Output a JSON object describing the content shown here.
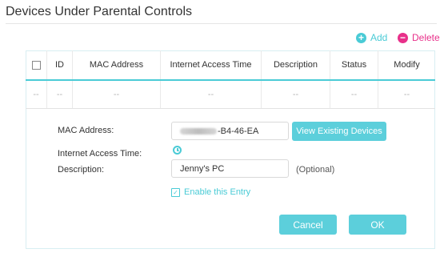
{
  "section": {
    "title": "Devices Under Parental Controls"
  },
  "toolbar": {
    "add_label": "Add",
    "delete_label": "Delete"
  },
  "table": {
    "headers": [
      "ID",
      "MAC Address",
      "Internet Access Time",
      "Description",
      "Status",
      "Modify"
    ],
    "placeholder_row": [
      "--",
      "--",
      "--",
      "--",
      "--",
      "--",
      "--"
    ]
  },
  "form": {
    "mac_label": "MAC Address:",
    "mac_value_visible": "-B4-46-EA",
    "view_devices_label": "View Existing Devices",
    "time_label": "Internet Access Time:",
    "desc_label": "Description:",
    "desc_value": "Jenny's PC",
    "optional_label": "(Optional)",
    "enable_label": "Enable this Entry",
    "enable_checked": true,
    "cancel_label": "Cancel",
    "ok_label": "OK"
  },
  "colors": {
    "accent": "#4acbd6",
    "delete": "#e8308a"
  },
  "icons": {
    "add": "plus-circle-icon",
    "delete": "minus-circle-icon",
    "time": "clock-icon"
  }
}
